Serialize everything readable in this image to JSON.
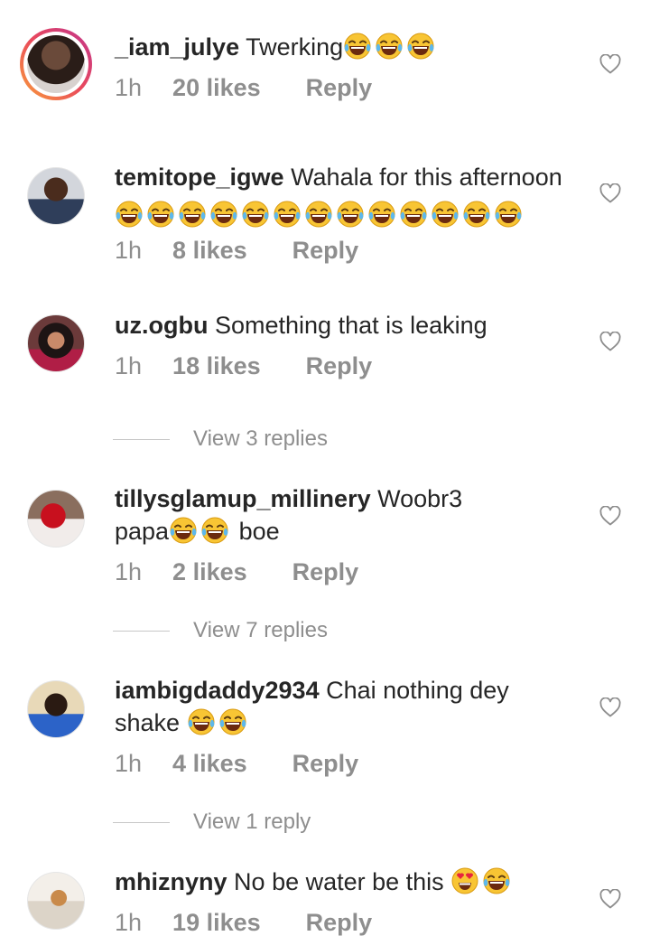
{
  "comments": [
    {
      "username": "_iam_julye",
      "text": "Twerking",
      "emojis_after": 3,
      "time": "1h",
      "likes": "20 likes",
      "reply": "Reply"
    },
    {
      "username": "temitope_igwe",
      "text": "Wahala for this afternoon",
      "emojis_line2": 13,
      "time": "1h",
      "likes": "8 likes",
      "reply": "Reply"
    },
    {
      "username": "uz.ogbu",
      "text": "Something that is leaking",
      "time": "1h",
      "likes": "18 likes",
      "reply": "Reply",
      "view_replies": "View 3 replies"
    },
    {
      "username": "tillysglamup_millinery",
      "text": "Woobr3",
      "text2a": "papa",
      "text2b": "boe",
      "time": "1h",
      "likes": "2 likes",
      "reply": "Reply",
      "view_replies": "View 7 replies"
    },
    {
      "username": "iambigdaddy2934",
      "text": "Chai nothing dey",
      "text2": "shake",
      "time": "1h",
      "likes": "4 likes",
      "reply": "Reply",
      "view_replies": "View 1 reply"
    },
    {
      "username": "mhiznyny",
      "text": "No be water be this",
      "time": "1h",
      "likes": "19 likes",
      "reply": "Reply"
    }
  ],
  "icons": {
    "like": "heart-outline-icon",
    "laugh": "face-with-tears-of-joy-emoji",
    "love": "heart-eyes-emoji"
  },
  "colors": {
    "text": "#262626",
    "muted": "#8e8e8e",
    "emoji": "#f8c534"
  }
}
